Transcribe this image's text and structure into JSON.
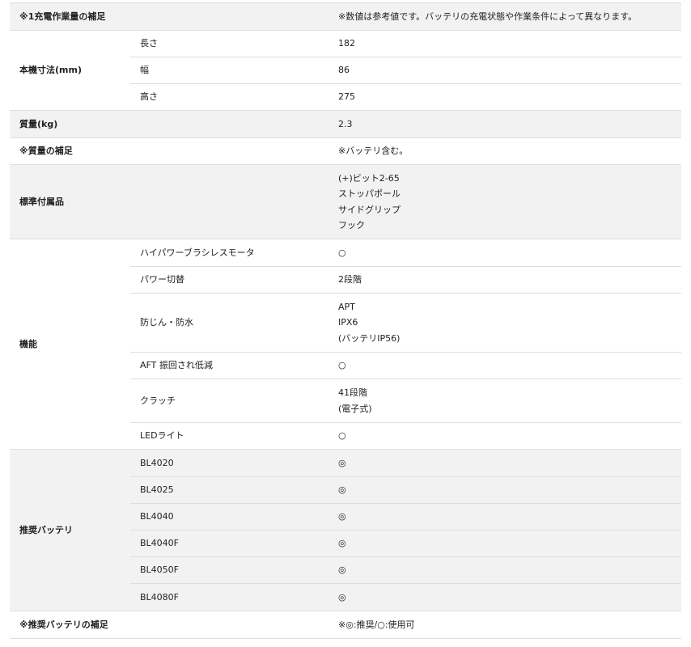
{
  "spec_table": {
    "charge_note": {
      "label": "※1充電作業量の補足",
      "value": "※数値は参考値です。バッテリの充電状態や作業条件によって異なります。"
    },
    "dimensions": {
      "label": "本機寸法(mm)",
      "rows": [
        {
          "label": "長さ",
          "value": "182"
        },
        {
          "label": "幅",
          "value": "86"
        },
        {
          "label": "高さ",
          "value": "275"
        }
      ]
    },
    "mass": {
      "label": "質量(kg)",
      "value": "2.3"
    },
    "mass_note": {
      "label": "※質量の補足",
      "value": "※バッテリ含む。"
    },
    "accessories": {
      "label": "標準付属品",
      "items": [
        "(+)ビット2-65",
        "ストッパポール",
        "サイドグリップ",
        "フック"
      ]
    },
    "functions": {
      "label": "機能",
      "rows": [
        {
          "label": "ハイパワーブラシレスモータ",
          "values": [
            "○"
          ]
        },
        {
          "label": "パワー切替",
          "values": [
            "2段階"
          ]
        },
        {
          "label": "防じん・防水",
          "values": [
            "APT",
            "IPX6",
            "(バッテリIP56)"
          ]
        },
        {
          "label": "AFT 振回され低減",
          "values": [
            "○"
          ]
        },
        {
          "label": "クラッチ",
          "values": [
            "41段階",
            "(電子式)"
          ]
        },
        {
          "label": "LEDライト",
          "values": [
            "○"
          ]
        }
      ]
    },
    "batteries": {
      "label": "推奨バッテリ",
      "rows": [
        {
          "label": "BL4020",
          "value": "◎"
        },
        {
          "label": "BL4025",
          "value": "◎"
        },
        {
          "label": "BL4040",
          "value": "◎"
        },
        {
          "label": "BL4040F",
          "value": "◎"
        },
        {
          "label": "BL4050F",
          "value": "◎"
        },
        {
          "label": "BL4080F",
          "value": "◎"
        }
      ]
    },
    "battery_note": {
      "label": "※推奨バッテリの補足",
      "value": "※◎:推奨/○:使用可"
    }
  }
}
